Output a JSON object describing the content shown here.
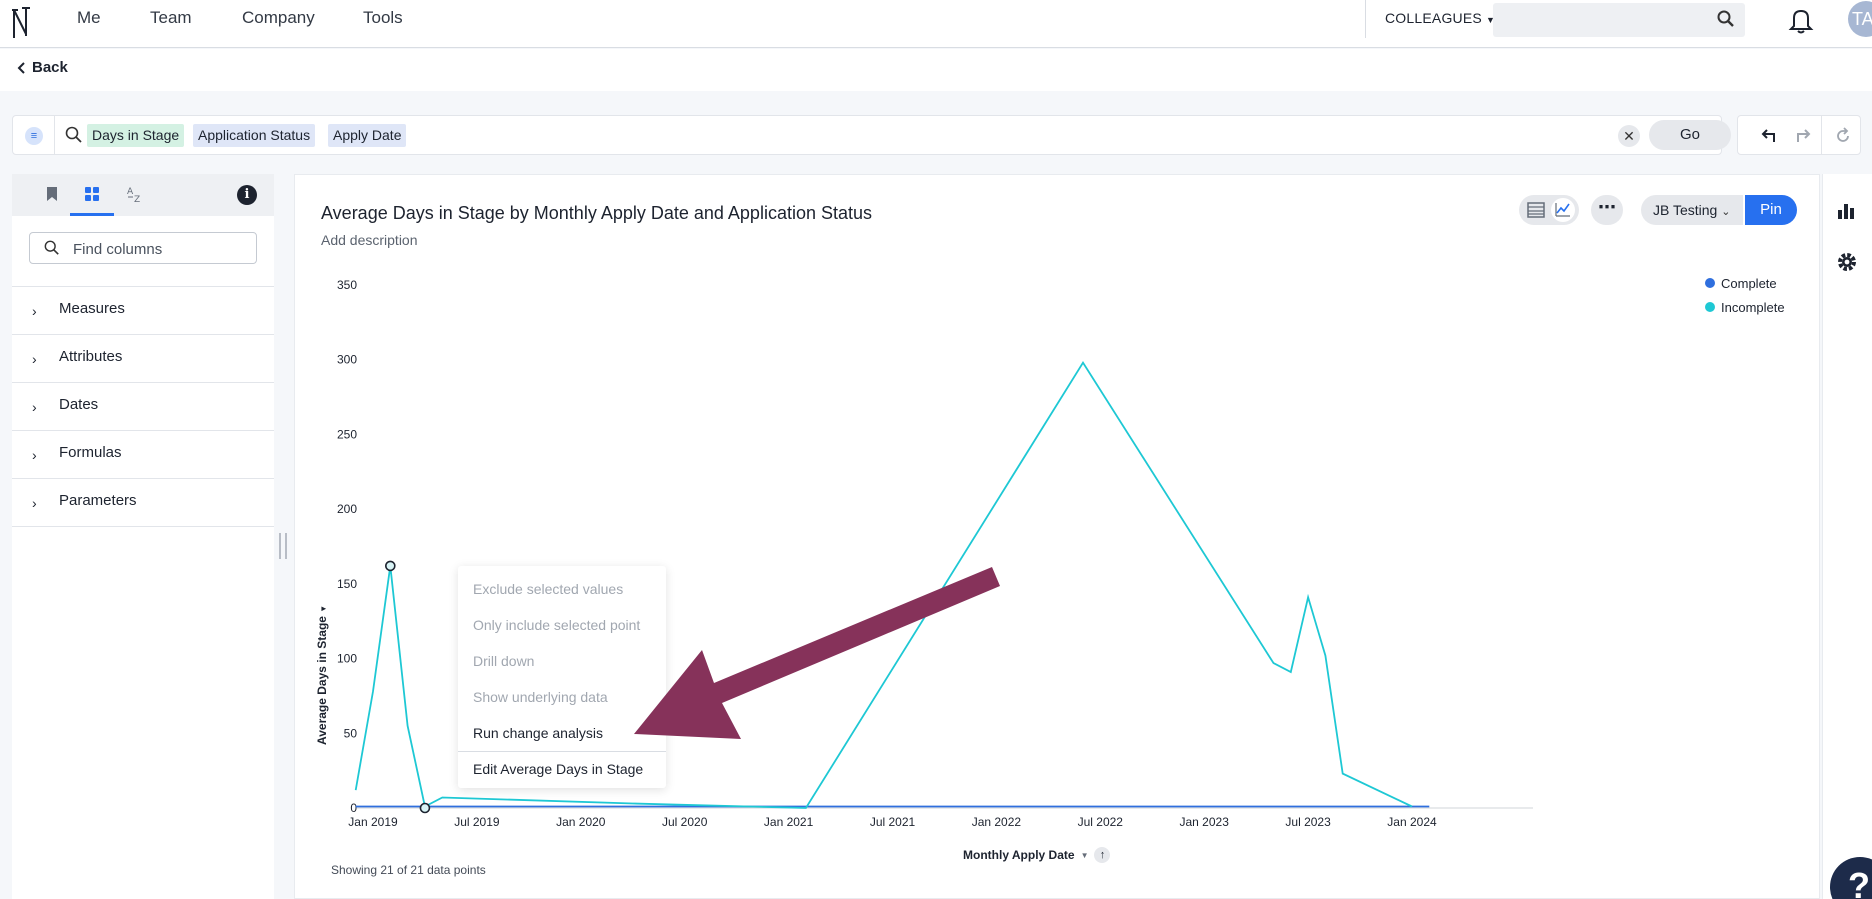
{
  "nav": {
    "items": [
      "Me",
      "Team",
      "Company",
      "Tools"
    ],
    "colleagues_label": "COLLEAGUES",
    "avatar_initials": "TA"
  },
  "back_label": "Back",
  "search": {
    "tokens": [
      {
        "label": "Days in Stage",
        "kind": "measure"
      },
      {
        "label": "Application Status",
        "kind": "attribute"
      },
      {
        "label": "Apply Date",
        "kind": "attribute"
      }
    ],
    "go_label": "Go"
  },
  "left_panel": {
    "find_placeholder": "Find columns",
    "sections": [
      "Measures",
      "Attributes",
      "Dates",
      "Formulas",
      "Parameters"
    ]
  },
  "card": {
    "title": "Average Days in Stage by Monthly Apply Date and Application Status",
    "add_description": "Add description",
    "liveboard_label": "JB Testing",
    "pin_label": "Pin",
    "showing_text": "Showing 21 of 21 data points"
  },
  "context_menu": {
    "items": [
      {
        "label": "Exclude selected values",
        "enabled": false
      },
      {
        "label": "Only include selected point",
        "enabled": false
      },
      {
        "label": "Drill down",
        "enabled": false
      },
      {
        "label": "Show underlying data",
        "enabled": false
      },
      {
        "label": "Run change analysis",
        "enabled": true
      },
      {
        "label": "Edit Average Days in Stage",
        "enabled": true
      }
    ]
  },
  "colors": {
    "complete": "#2f6fde",
    "incomplete": "#1ec8d4",
    "annotation_arrow": "#86325a",
    "accent": "#2770ef"
  },
  "chart_data": {
    "type": "line",
    "xlabel": "Monthly Apply Date",
    "ylabel": "Average Days in Stage",
    "ylim": [
      0,
      350
    ],
    "yticks": [
      0,
      50,
      100,
      150,
      200,
      250,
      300,
      350
    ],
    "xticks": [
      "Jan 2019",
      "Jul 2019",
      "Jan 2020",
      "Jul 2020",
      "Jan 2021",
      "Jul 2021",
      "Jan 2022",
      "Jul 2022",
      "Jan 2023",
      "Jul 2023",
      "Jan 2024"
    ],
    "legend_position": "top-right",
    "series": [
      {
        "name": "Complete",
        "points": [
          [
            "2018-12",
            1
          ],
          [
            "2019-02",
            1
          ],
          [
            "2019-04",
            1
          ],
          [
            "2024-01",
            1
          ],
          [
            "2024-02",
            1
          ]
        ]
      },
      {
        "name": "Incomplete",
        "points": [
          [
            "2018-12",
            12
          ],
          [
            "2019-01",
            78
          ],
          [
            "2019-02",
            162
          ],
          [
            "2019-03",
            55
          ],
          [
            "2019-04",
            1
          ],
          [
            "2019-05",
            7
          ],
          [
            "2020-04",
            3
          ],
          [
            "2021-02",
            0
          ],
          [
            "2022-06",
            298
          ],
          [
            "2023-05",
            97
          ],
          [
            "2023-06",
            91
          ],
          [
            "2023-07",
            141
          ],
          [
            "2023-08",
            102
          ],
          [
            "2023-09",
            23
          ],
          [
            "2024-01",
            1
          ]
        ]
      }
    ],
    "selected_points": [
      [
        "2019-02",
        162
      ],
      [
        "2019-04",
        0
      ]
    ]
  }
}
